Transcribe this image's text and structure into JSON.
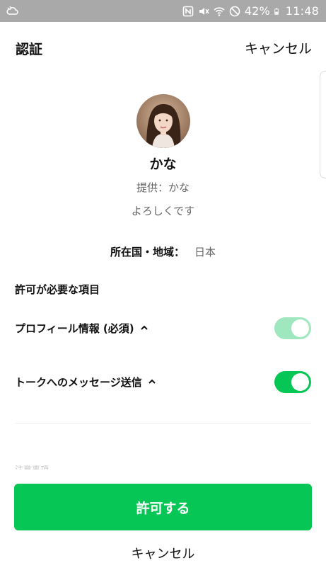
{
  "status_bar": {
    "battery_percent": "42%",
    "time": "11:48",
    "icons": [
      "cloud-sync-icon",
      "nfc-icon",
      "mute-icon",
      "wifi-icon",
      "do-not-disturb-icon",
      "battery-icon"
    ]
  },
  "header": {
    "title": "認証",
    "cancel_label": "キャンセル"
  },
  "profile": {
    "name": "かな",
    "provider": "提供：かな",
    "description": "よろしくです"
  },
  "region": {
    "label": "所在国・地域：",
    "value": "日本"
  },
  "permissions": {
    "section_title": "許可が必要な項目",
    "items": [
      {
        "label": "プロフィール情報 (必須)",
        "enabled": true,
        "locked": true,
        "color": "#9fe8bf"
      },
      {
        "label": "トークへのメッセージ送信",
        "enabled": true,
        "locked": false,
        "color": "#06c755"
      }
    ]
  },
  "faded_label": "注意事項",
  "actions": {
    "allow_label": "許可する",
    "cancel_label": "キャンセル"
  },
  "colors": {
    "accent": "#06c755",
    "status_bar": "#a9a9a9"
  }
}
